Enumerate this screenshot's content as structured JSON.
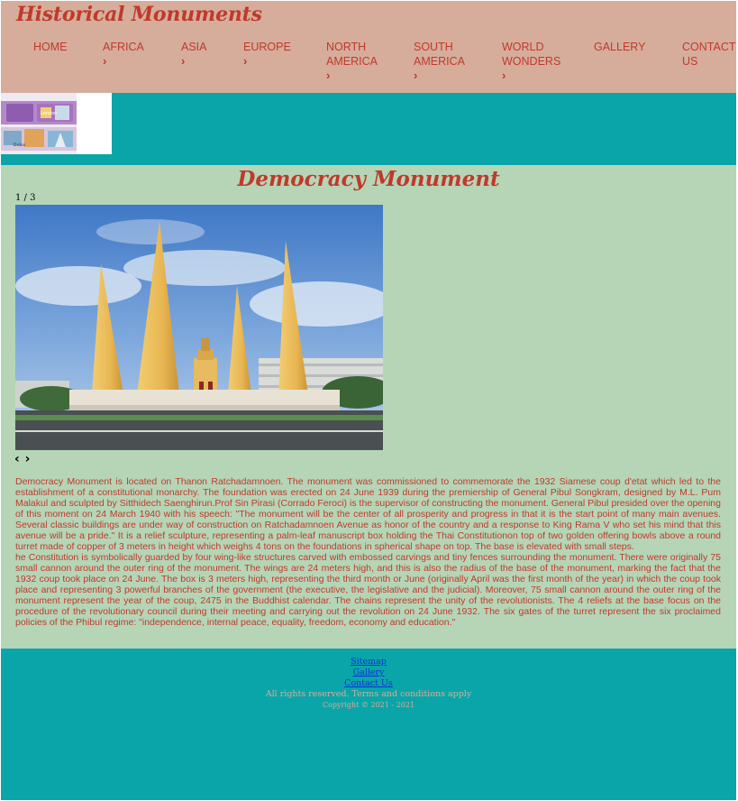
{
  "site": {
    "title": "Historical Monuments"
  },
  "nav": [
    {
      "label": "HOME",
      "has_submenu": false
    },
    {
      "label": "AFRICA",
      "has_submenu": true
    },
    {
      "label": "ASIA",
      "has_submenu": true
    },
    {
      "label": "EUROPE",
      "has_submenu": true
    },
    {
      "label": "NORTH AMERICA",
      "has_submenu": true
    },
    {
      "label": "SOUTH AMERICA",
      "has_submenu": true
    },
    {
      "label": "WORLD WONDERS",
      "has_submenu": true
    },
    {
      "label": "GALLERY",
      "has_submenu": false
    },
    {
      "label": "CONTACT US",
      "has_submenu": false
    }
  ],
  "banner": {
    "caption_top": "London",
    "caption_bottom": "Dubai"
  },
  "article": {
    "title": "Democracy Monument",
    "slide_counter": "1 / 3",
    "prev_arrow": "‹",
    "next_arrow": "›",
    "paragraph1": "Democracy Monument is located on Thanon Ratchadamnoen. The monument was commissioned to commemorate the 1932 Siamese coup d'etat which led to the establishment of a constitutional monarchy. The foundation was erected on 24 June 1939 during the premiership of General Pibul Songkram, designed by M.L. Pum Malakul and sculpted by Sitthidech Saenghirun.Prof Sin Pirasi (Corrado Feroci) is the supervisor of constructing the monument. General Pibul presided over the opening of this moment on 24 March 1940 with his speech: \"The monument will be the center of all prosperity and progress in that it is the start point of many main avenues. Several classic buildings are under way of construction on Ratchadamnoen Avenue as honor of the country and a response to King Rama V who set his mind that this avenue will be a pride.\" It is a relief sculpture, representing a palm-leaf manuscript box holding the Thai Constitutionon top of two golden offering bowls above a round turret made of copper of 3 meters in height which weighs 4 tons on the foundations in spherical shape on top. The base is elevated with small steps.",
    "paragraph2": "he Constitution is symbolically guarded by four wing-like structures carved with embossed carvings and tiny fences surrounding the monument. There were originally 75 small cannon around the outer ring of the monument. The wings are 24 meters high, and this is also the radius of the base of the monument, marking the fact that the 1932 coup took place on 24 June. The box is 3 meters high, representing the third month or June (originally April was the first month of the year) in which the coup took place and representing 3 powerful branches of the government (the executive, the legislative and the judicial). Moreover, 75 small cannon around the outer ring of the monument represent the year of the coup, 2475 in the Buddhist calendar. The chains represent the unity of the revolutionists. The 4 reliefs at the base focus on the procedure of the revolutionary council during their meeting and carrying out the revolution on 24 June 1932. The six gates of the turret represent the six proclaimed policies of the Phibul regime: \"independence, internal peace, equality, freedom, economy and education.\""
  },
  "footer": {
    "links": [
      "Sitemap",
      "Gallery",
      "Contact Us"
    ],
    "rights": "All rights reserved. Terms and conditions apply",
    "copyright": "Copyright © 2021 - 2021"
  },
  "colors": {
    "header_bg": "#d6ad9b",
    "accent_red": "#c0392b",
    "teal": "#0aa5a8",
    "content_bg": "#b5d5b6"
  }
}
